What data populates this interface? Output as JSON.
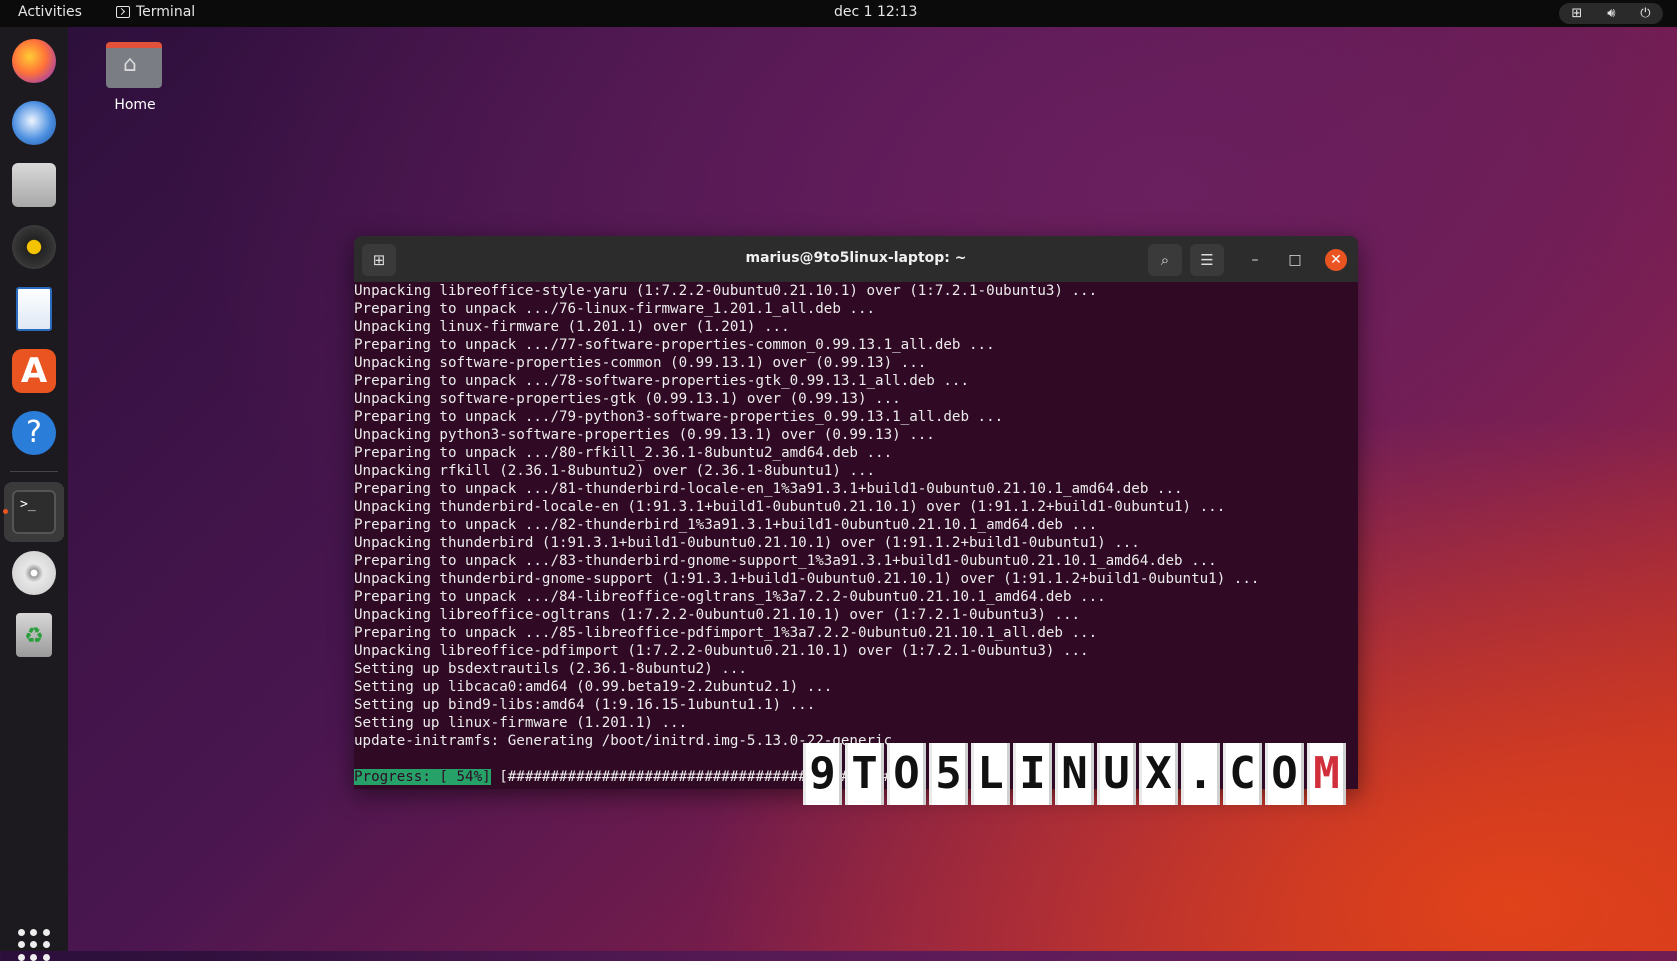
{
  "topbar": {
    "activities": "Activities",
    "app_name": "Terminal",
    "clock": "dec 1  12:13",
    "tray_icons": [
      "network-icon",
      "volume-icon",
      "power-icon"
    ]
  },
  "dock": {
    "apps": [
      "Firefox",
      "Thunderbird",
      "Files",
      "Rhythmbox",
      "LibreOffice Writer",
      "Ubuntu Software",
      "Help",
      "Terminal",
      "Disc",
      "Trash"
    ],
    "running": "Terminal"
  },
  "desktop": {
    "home_label": "Home"
  },
  "window": {
    "title": "marius@9to5linux-laptop: ~",
    "lines": [
      "Unpacking libreoffice-style-yaru (1:7.2.2-0ubuntu0.21.10.1) over (1:7.2.1-0ubuntu3) ...",
      "Preparing to unpack .../76-linux-firmware_1.201.1_all.deb ...",
      "Unpacking linux-firmware (1.201.1) over (1.201) ...",
      "Preparing to unpack .../77-software-properties-common_0.99.13.1_all.deb ...",
      "Unpacking software-properties-common (0.99.13.1) over (0.99.13) ...",
      "Preparing to unpack .../78-software-properties-gtk_0.99.13.1_all.deb ...",
      "Unpacking software-properties-gtk (0.99.13.1) over (0.99.13) ...",
      "Preparing to unpack .../79-python3-software-properties_0.99.13.1_all.deb ...",
      "Unpacking python3-software-properties (0.99.13.1) over (0.99.13) ...",
      "Preparing to unpack .../80-rfkill_2.36.1-8ubuntu2_amd64.deb ...",
      "Unpacking rfkill (2.36.1-8ubuntu2) over (2.36.1-8ubuntu1) ...",
      "Preparing to unpack .../81-thunderbird-locale-en_1%3a91.3.1+build1-0ubuntu0.21.10.1_amd64.deb ...",
      "Unpacking thunderbird-locale-en (1:91.3.1+build1-0ubuntu0.21.10.1) over (1:91.1.2+build1-0ubuntu1) ...",
      "Preparing to unpack .../82-thunderbird_1%3a91.3.1+build1-0ubuntu0.21.10.1_amd64.deb ...",
      "Unpacking thunderbird (1:91.3.1+build1-0ubuntu0.21.10.1) over (1:91.1.2+build1-0ubuntu1) ...",
      "Preparing to unpack .../83-thunderbird-gnome-support_1%3a91.3.1+build1-0ubuntu0.21.10.1_amd64.deb ...",
      "Unpacking thunderbird-gnome-support (1:91.3.1+build1-0ubuntu0.21.10.1) over (1:91.1.2+build1-0ubuntu1) ...",
      "Preparing to unpack .../84-libreoffice-ogltrans_1%3a7.2.2-0ubuntu0.21.10.1_amd64.deb ...",
      "Unpacking libreoffice-ogltrans (1:7.2.2-0ubuntu0.21.10.1) over (1:7.2.1-0ubuntu3) ...",
      "Preparing to unpack .../85-libreoffice-pdfimport_1%3a7.2.2-0ubuntu0.21.10.1_all.deb ...",
      "Unpacking libreoffice-pdfimport (1:7.2.2-0ubuntu0.21.10.1) over (1:7.2.1-0ubuntu3) ...",
      "Setting up bsdextrautils (2.36.1-8ubuntu2) ...",
      "Setting up libcaca0:amd64 (0.99.beta19-2.2ubuntu2.1) ...",
      "Setting up bind9-libs:amd64 (1:9.16.15-1ubuntu1.1) ...",
      "Setting up linux-firmware (1.201.1) ...",
      "update-initramfs: Generating /boot/initrd.img-5.13.0-22-generic"
    ],
    "progress_label": "Progress: [ 54%]",
    "progress_bar": "[##############################################",
    "progress_percent": 54
  },
  "watermark": {
    "letters": [
      "9",
      "T",
      "O",
      "5",
      "L",
      "I",
      "N",
      "U",
      "X",
      ".",
      "C",
      "O",
      "M"
    ],
    "accent_color": "#d12f3b"
  },
  "colors": {
    "terminal_bg": "#300a24",
    "accent": "#e95420",
    "progress_bg": "#26a269"
  }
}
